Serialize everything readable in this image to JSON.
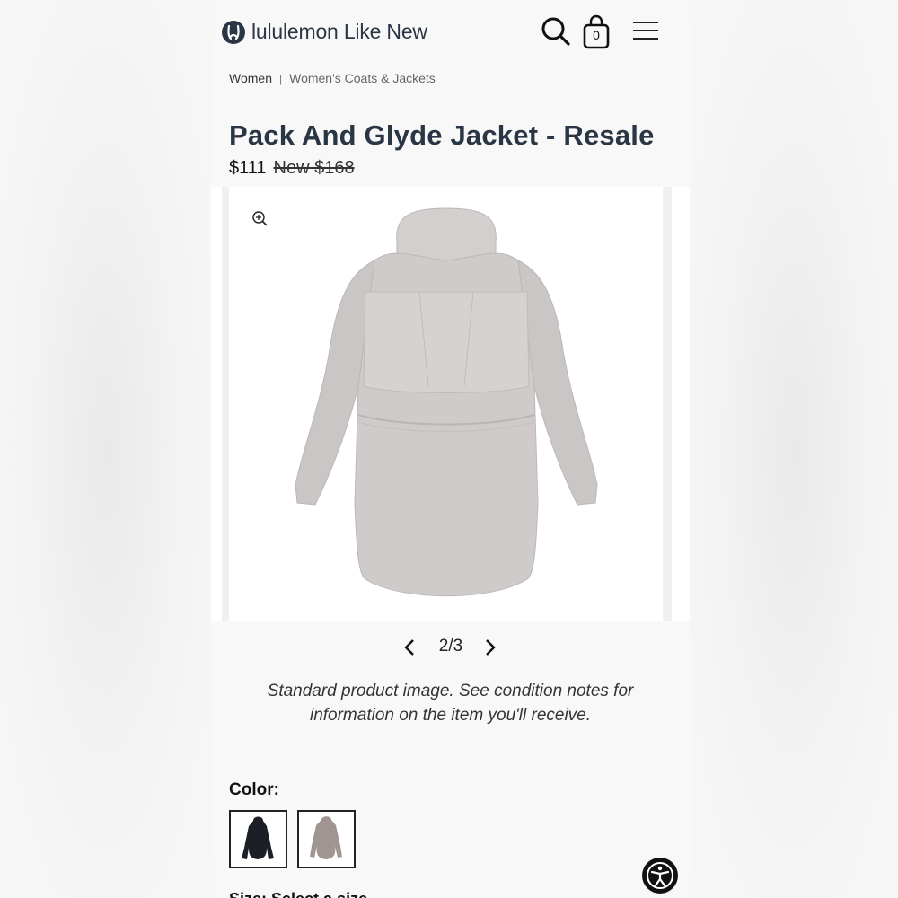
{
  "header": {
    "brand_text": "lululemon Like New",
    "bag_count": "0",
    "icons": [
      "lululemon-logo-icon",
      "search-icon",
      "shopping-bag-icon",
      "hamburger-menu-icon"
    ]
  },
  "breadcrumb": {
    "items": [
      "Women",
      "Women's Coats & Jackets"
    ],
    "separator": "|"
  },
  "product": {
    "title": "Pack And Glyde Jacket - Resale",
    "price": "$111",
    "original_price": "New $168"
  },
  "gallery": {
    "counter": "2/3",
    "note": "Standard product image. See condition notes for information on the item you'll receive."
  },
  "color": {
    "label": "Color:",
    "swatches": [
      "black",
      "grey"
    ]
  },
  "size": {
    "label_partial": "Size: Select a size"
  },
  "colors": {
    "brand_navy": "#2b3645",
    "jacket_grey": "#cdc9c8",
    "jacket_black": "#1c1f26",
    "swatch_grey": "#a09590"
  }
}
